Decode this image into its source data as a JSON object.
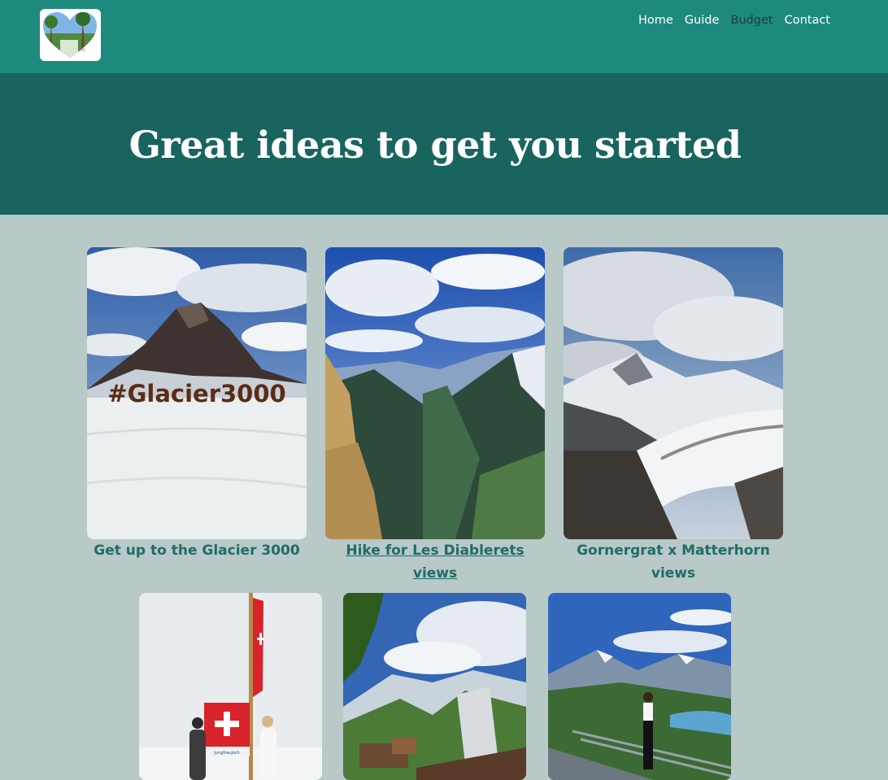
{
  "header": {
    "logo_alt": "",
    "nav": [
      {
        "label": "Home",
        "active": false
      },
      {
        "label": "Guide",
        "active": false
      },
      {
        "label": "Budget",
        "active": true
      },
      {
        "label": "Contact",
        "active": false
      }
    ]
  },
  "hero": {
    "title": "Great ideas to get you started"
  },
  "gallery": {
    "row1": [
      {
        "caption": "Get up to the Glacier 3000",
        "is_link": false,
        "sign_text": "#Glacier3000"
      },
      {
        "caption": "Hike for Les Diablerets views",
        "is_link": true
      },
      {
        "caption": "Gornergrat x Matterhorn views",
        "is_link": false
      }
    ],
    "row2": [
      {
        "caption": "",
        "sign_text": "Jungfraujoch"
      },
      {
        "caption": ""
      },
      {
        "caption": ""
      }
    ]
  },
  "colors": {
    "header_bg": "#1e8a7d",
    "hero_bg": "#19645f",
    "page_bg": "#b8c9c8",
    "caption": "#1f6d66"
  }
}
